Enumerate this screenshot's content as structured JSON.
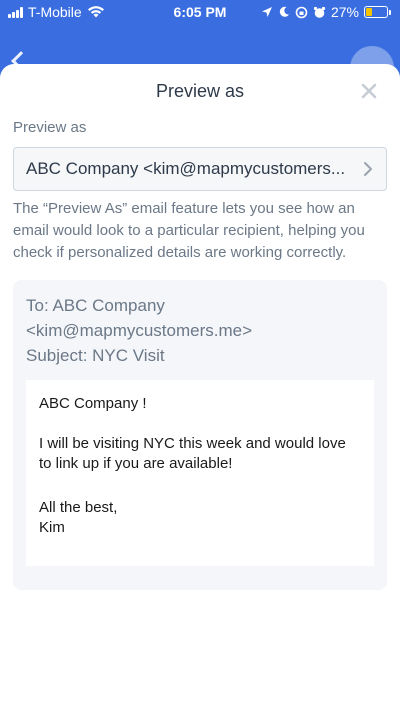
{
  "status_bar": {
    "carrier": "T-Mobile",
    "time": "6:05 PM",
    "battery": "27%",
    "battery_level": 0.27
  },
  "modal": {
    "title": "Preview as",
    "close_icon": "close-icon",
    "field_label": "Preview as",
    "selected_recipient": "ABC Company <kim@mapmycustomers...",
    "help_text": "The “Preview As” email feature lets you see how an email would look to a particular recipient, helping you check if personalized details are working correctly."
  },
  "preview": {
    "to_line": "To: ABC Company",
    "to_email": "<kim@mapmycustomers.me>",
    "subject": "Subject: NYC Visit",
    "body": {
      "greeting": "ABC Company !",
      "message": "I will be visiting NYC this week and would love to link up if you are available!",
      "signoff": "All the best,",
      "signature": "Kim"
    }
  },
  "colors": {
    "header_blue": "#3a6ee0",
    "text_primary": "#2e3a4a",
    "text_muted": "#6b7887",
    "battery_yellow": "#f5c400"
  }
}
